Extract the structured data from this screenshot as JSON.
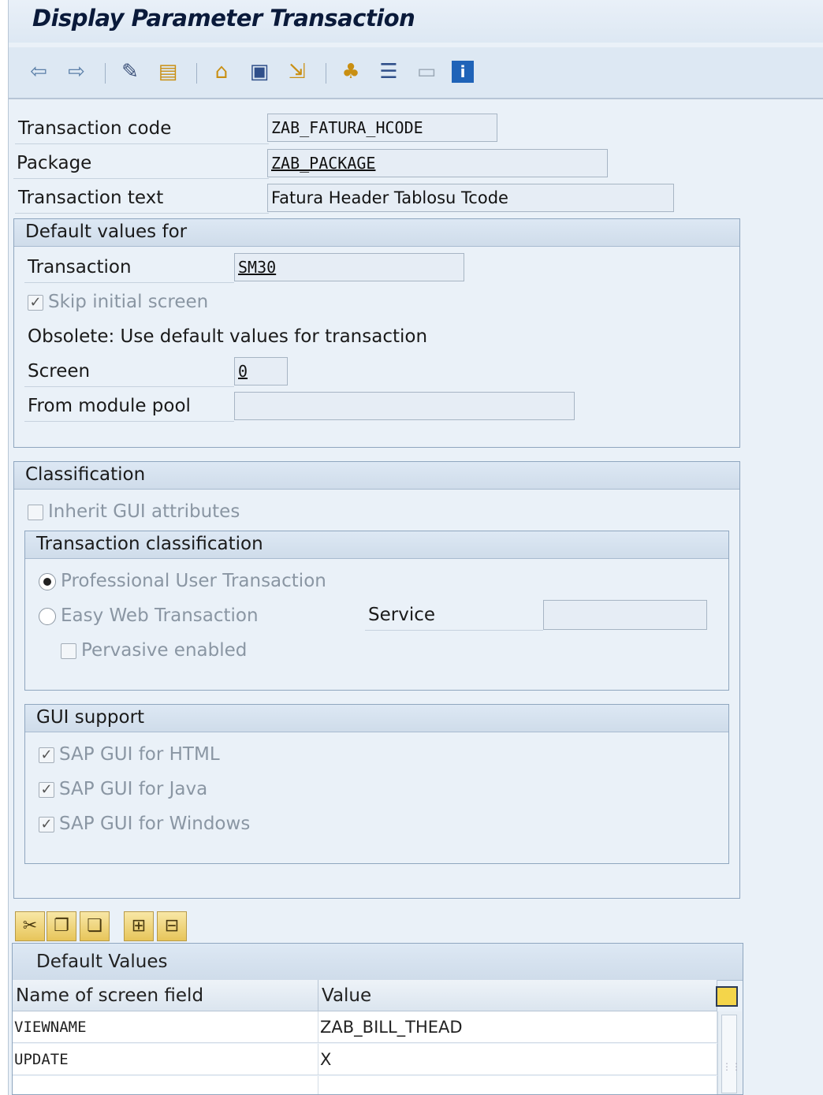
{
  "window": {
    "title": "Display Parameter Transaction"
  },
  "toolbar": {
    "icons": [
      "back-arrow-icon",
      "forward-arrow-icon",
      "display-change-icon",
      "other-object-icon",
      "where-used-icon",
      "transport-icon",
      "dependent-icon",
      "hierarchy-icon",
      "align-icon",
      "layout-icon",
      "info-icon"
    ]
  },
  "header": {
    "transaction_code_label": "Transaction code",
    "transaction_code_value": "ZAB_FATURA_HCODE",
    "package_label": "Package",
    "package_value": "ZAB_PACKAGE",
    "transaction_text_label": "Transaction text",
    "transaction_text_value": "Fatura Header Tablosu Tcode"
  },
  "defaults": {
    "title": "Default values for",
    "transaction_label": "Transaction",
    "transaction_value": "SM30",
    "skip_initial_screen_label": "Skip initial screen",
    "skip_initial_screen_checked": true,
    "obsolete_text": "Obsolete: Use default values for transaction",
    "screen_label": "Screen",
    "screen_value": "0",
    "module_pool_label": "From module pool",
    "module_pool_value": ""
  },
  "classification": {
    "title": "Classification",
    "inherit_gui_label": "Inherit GUI attributes",
    "inherit_gui_checked": false,
    "transaction_classification_title": "Transaction classification",
    "professional_label": "Professional User Transaction",
    "professional_selected": true,
    "easy_web_label": "Easy Web Transaction",
    "easy_web_selected": false,
    "service_label": "Service",
    "service_value": "",
    "pervasive_label": "Pervasive enabled",
    "pervasive_checked": false,
    "gui_support_title": "GUI support",
    "gui_html_label": "SAP GUI for HTML",
    "gui_java_label": "SAP GUI for Java",
    "gui_windows_label": "SAP GUI for Windows",
    "gui_html_checked": true,
    "gui_java_checked": true,
    "gui_windows_checked": true
  },
  "table_toolbar": {
    "icons": [
      "cut-icon",
      "copy-icon",
      "paste-icon",
      "insert-row-icon",
      "delete-row-icon"
    ]
  },
  "default_values_table": {
    "caption": "Default Values",
    "columns": [
      "Name of screen field",
      "Value"
    ],
    "rows": [
      [
        "VIEWNAME",
        "ZAB_BILL_THEAD"
      ],
      [
        "UPDATE",
        "X"
      ]
    ]
  },
  "colors": {
    "background": "#eaf1f8",
    "group_header": "#cfdcea",
    "disabled_text": "#8a96a3"
  }
}
